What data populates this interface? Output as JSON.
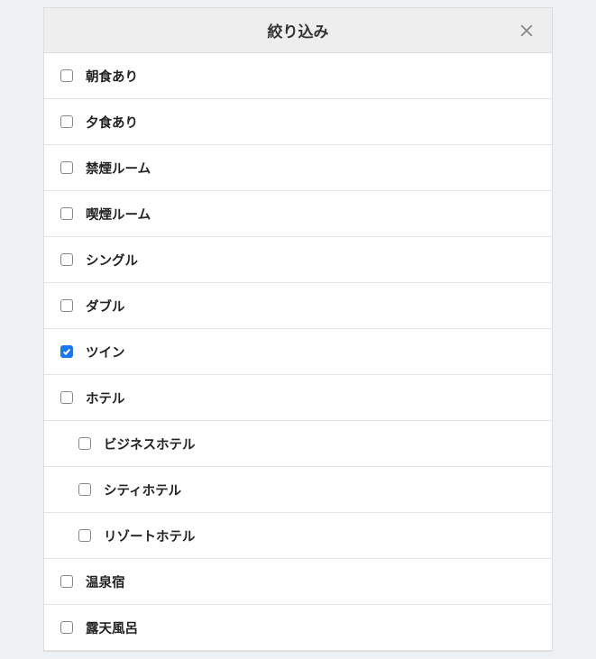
{
  "header": {
    "title": "絞り込み"
  },
  "options": [
    {
      "label": "朝食あり",
      "checked": false,
      "indent": false
    },
    {
      "label": "夕食あり",
      "checked": false,
      "indent": false
    },
    {
      "label": "禁煙ルーム",
      "checked": false,
      "indent": false
    },
    {
      "label": "喫煙ルーム",
      "checked": false,
      "indent": false
    },
    {
      "label": "シングル",
      "checked": false,
      "indent": false
    },
    {
      "label": "ダブル",
      "checked": false,
      "indent": false
    },
    {
      "label": "ツイン",
      "checked": true,
      "indent": false
    },
    {
      "label": "ホテル",
      "checked": false,
      "indent": false
    },
    {
      "label": "ビジネスホテル",
      "checked": false,
      "indent": true
    },
    {
      "label": "シティホテル",
      "checked": false,
      "indent": true
    },
    {
      "label": "リゾートホテル",
      "checked": false,
      "indent": true
    },
    {
      "label": "温泉宿",
      "checked": false,
      "indent": false
    },
    {
      "label": "露天風呂",
      "checked": false,
      "indent": false
    }
  ]
}
